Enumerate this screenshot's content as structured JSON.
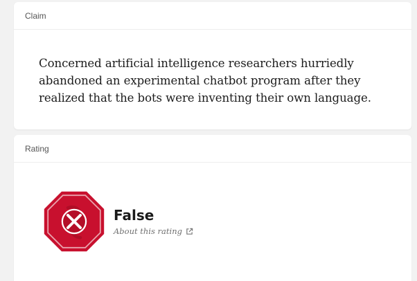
{
  "claim": {
    "header": "Claim",
    "text": "Concerned artificial intelligence researchers hurriedly abandoned an experimental chatbot program after they realized that the bots were inventing their own language."
  },
  "rating": {
    "header": "Rating",
    "label": "False",
    "about_link": "About this rating",
    "icon": "false-rating-stop-sign-icon",
    "link_icon": "external-link-icon",
    "colors": {
      "badge_red": "#c8102e",
      "badge_dark": "#a50d24",
      "badge_light": "#e2445a"
    }
  }
}
